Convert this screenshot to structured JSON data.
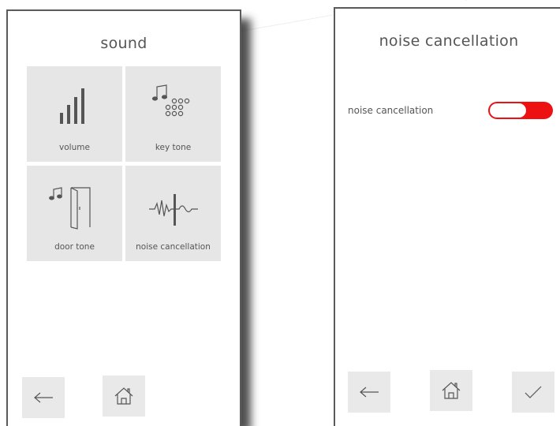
{
  "sound_screen": {
    "title": "sound",
    "tiles": [
      {
        "label": "volume",
        "icon": "volume-bars-icon"
      },
      {
        "label": "key tone",
        "icon": "keypad-music-icon"
      },
      {
        "label": "door tone",
        "icon": "door-music-icon"
      },
      {
        "label": "noise cancellation",
        "icon": "waveform-icon"
      }
    ],
    "nav": [
      "back-arrow-icon",
      "home-icon"
    ]
  },
  "noise_screen": {
    "title": "noise cancellation",
    "setting_label": "noise cancellation",
    "toggle_state": "on",
    "nav": [
      "back-arrow-icon",
      "home-icon",
      "checkmark-icon"
    ]
  },
  "colors": {
    "accent": "#ee1111",
    "tile_bg": "#e6e6e6",
    "text": "#555555",
    "border": "#5a5a5a"
  }
}
